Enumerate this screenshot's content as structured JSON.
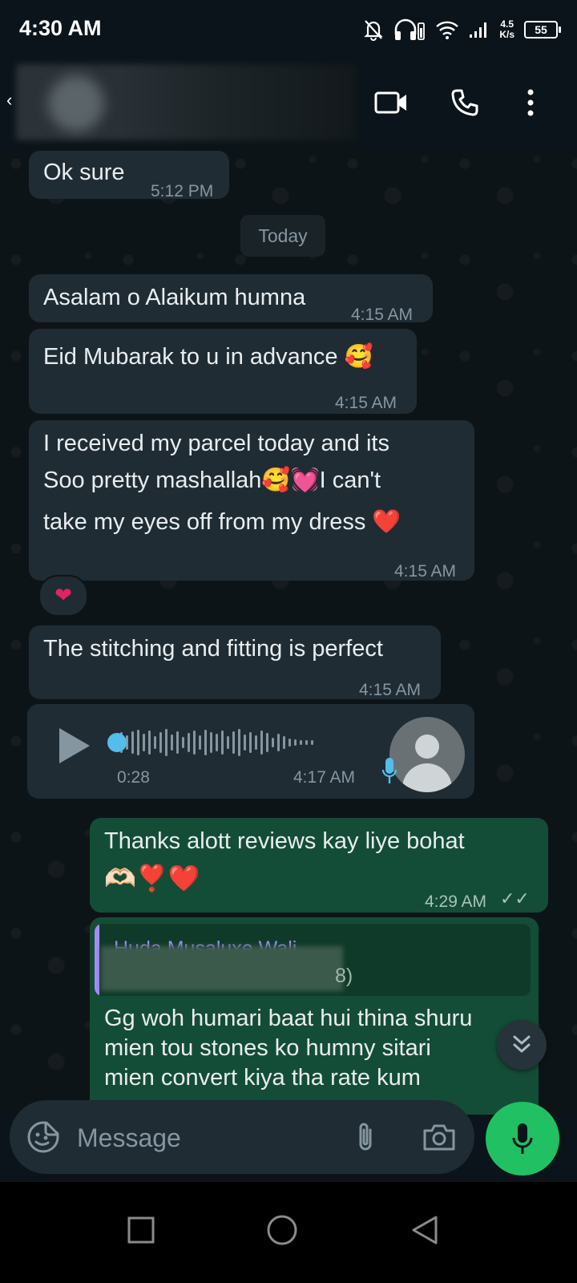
{
  "status_bar": {
    "time": "4:30 AM",
    "net_speed_value": "4.5",
    "net_speed_unit": "K/s",
    "battery": "55"
  },
  "header": {
    "icons": [
      "back-icon",
      "video-call-icon",
      "voice-call-icon",
      "more-options-icon"
    ]
  },
  "messages": [
    {
      "direction": "in",
      "text": "Ok sure",
      "time": "5:12 PM"
    },
    {
      "direction": "in",
      "text": "Asalam o Alaikum humna",
      "time": "4:15 AM"
    },
    {
      "direction": "in",
      "text": "Eid Mubarak to u in advance 🥰",
      "time": "4:15 AM"
    },
    {
      "direction": "in",
      "line1": "I received my parcel today and its",
      "line2": "Soo pretty mashallah🥰💓I can't",
      "line3": "take my eyes off from my dress ❤️",
      "time": "4:15 AM"
    },
    {
      "direction": "in",
      "text": "The stitching and fitting is  perfect",
      "time": "4:15 AM"
    },
    {
      "direction": "out",
      "line1": "Thanks alott reviews kay liye bohat",
      "line2": "🫶🏻❣️❤️",
      "time": "4:29 AM",
      "ticks": "✓✓"
    },
    {
      "direction": "out",
      "line1": "Gg woh humari baat hui thina shuru",
      "line2": "mien tou stones ko humny sitari",
      "line3": "mien convert kiya  tha rate kum"
    }
  ],
  "date_divider": "Today",
  "reaction": "❤",
  "voice_note": {
    "duration": "0:28",
    "time": "4:17 AM"
  },
  "quote": {
    "name": "Huda Musaluxe Wali",
    "suffix": "8)"
  },
  "composer": {
    "placeholder": "Message"
  },
  "nav": [
    "recents-button",
    "home-button",
    "back-button"
  ]
}
